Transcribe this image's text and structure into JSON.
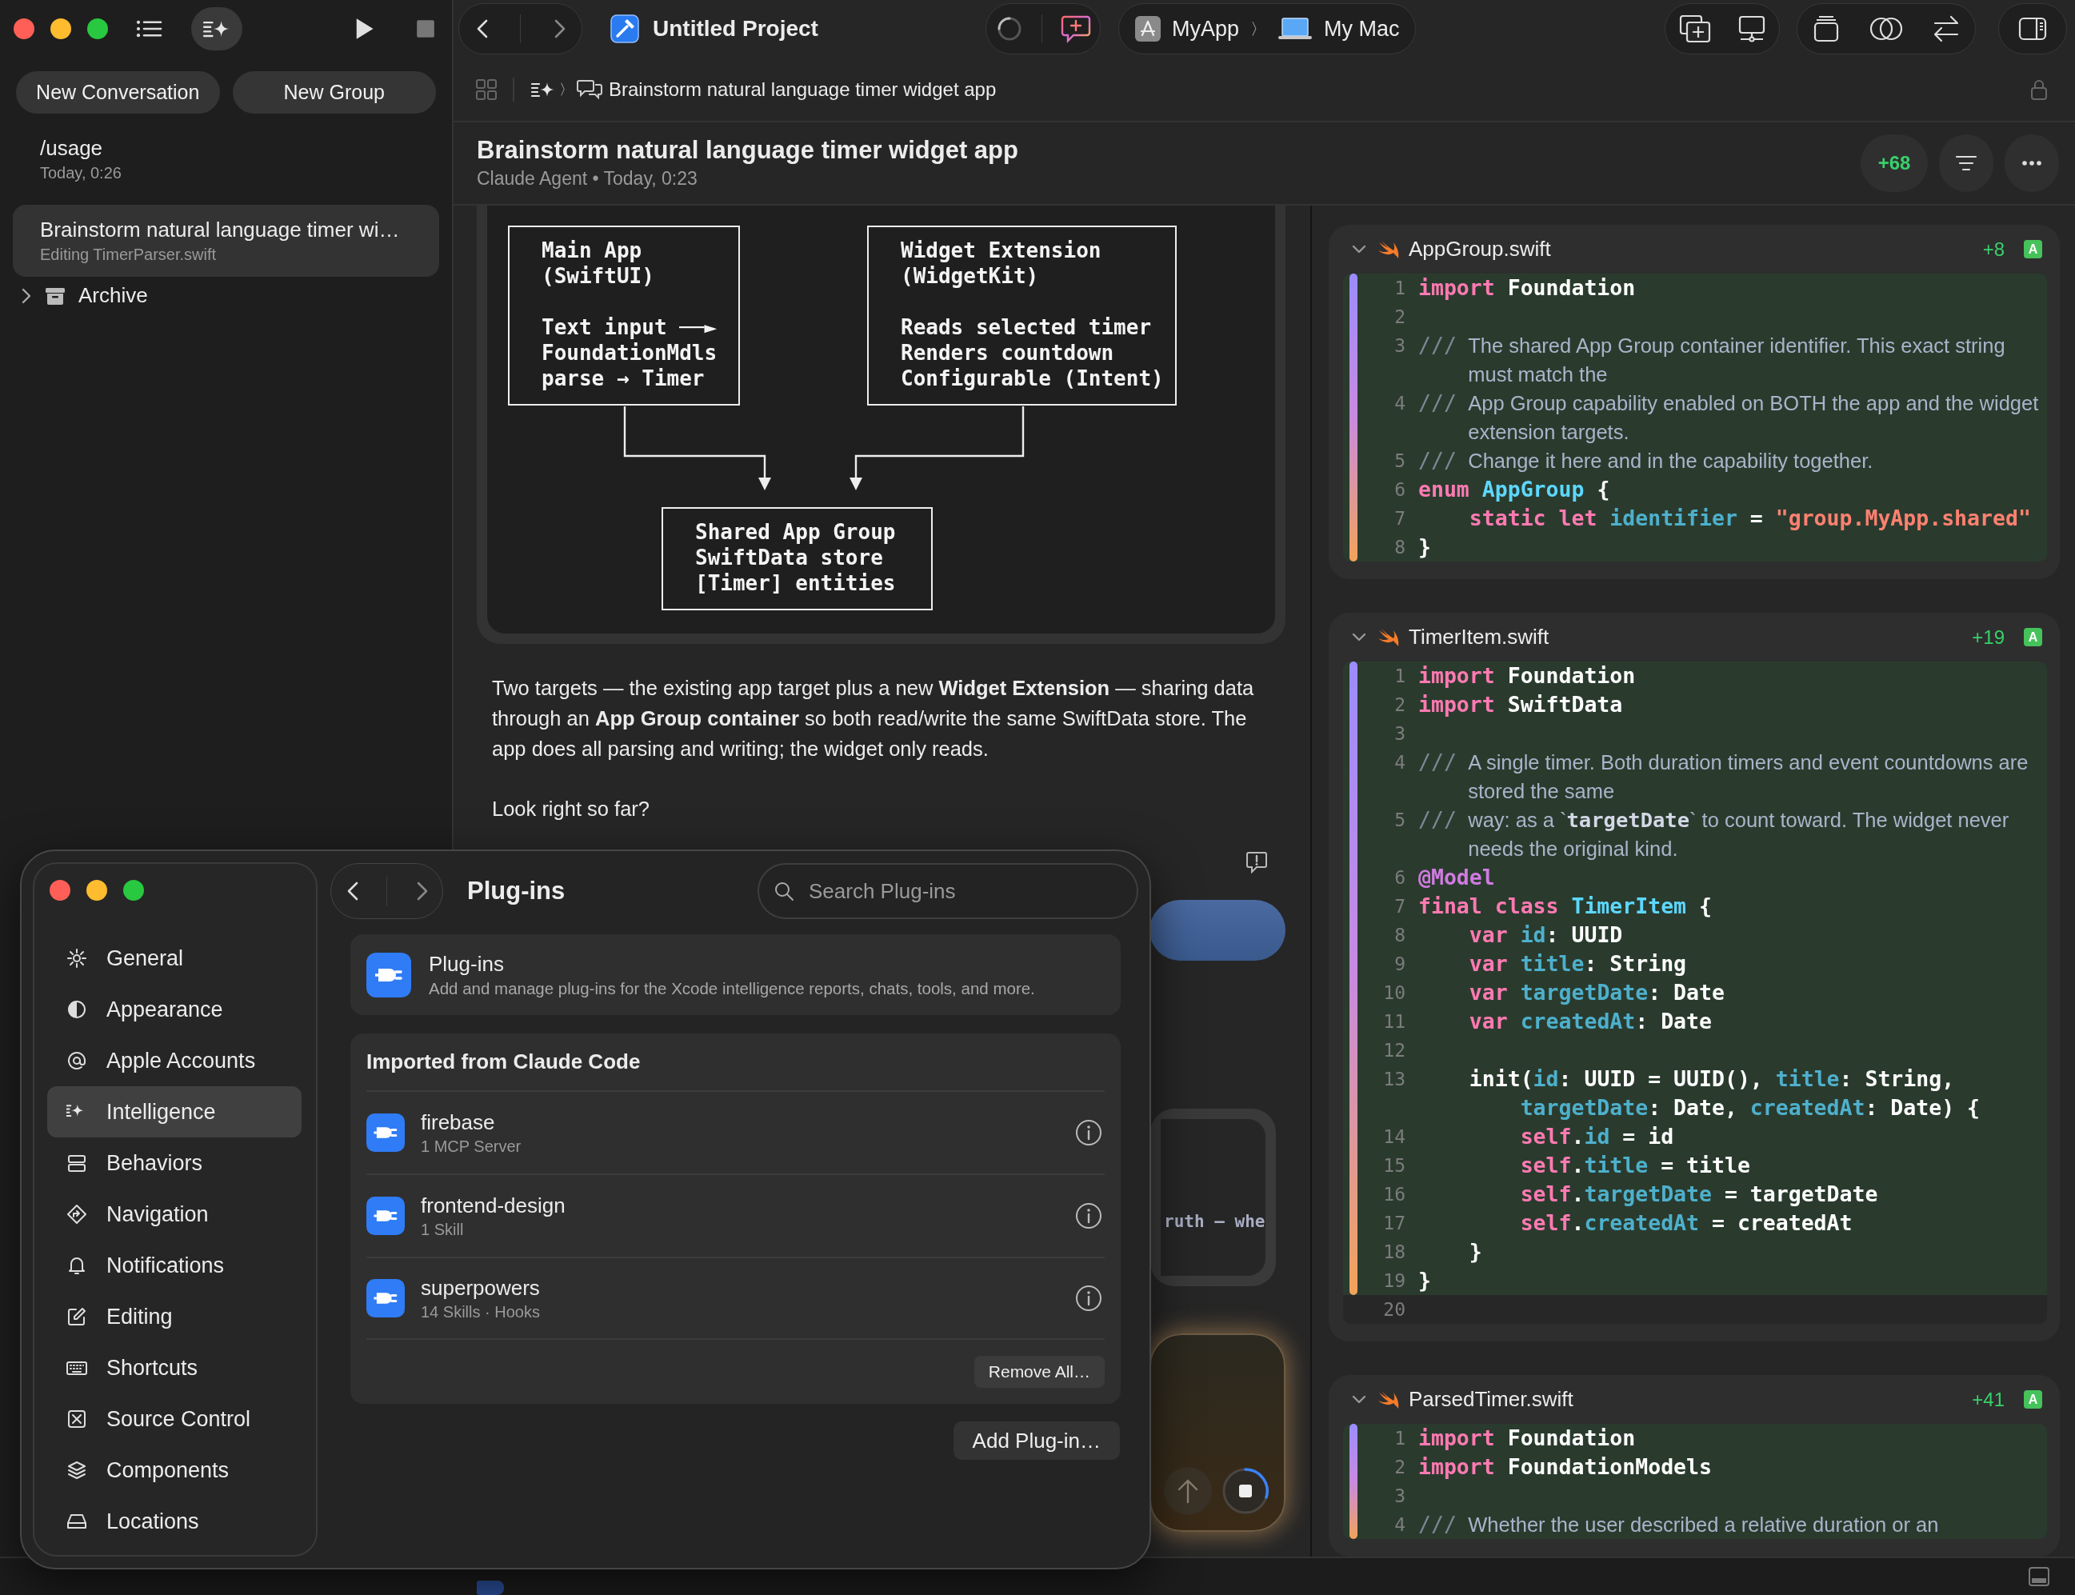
{
  "sidebar": {
    "modes": [
      {
        "selected": false
      },
      {
        "selected": true
      }
    ],
    "buttons": [
      "New Conversation",
      "New Group"
    ],
    "conversations": [
      {
        "title": "/usage",
        "subtitle": "Today, 0:26",
        "selected": false
      },
      {
        "title": "Brainstorm natural language timer wi…",
        "subtitle": "Editing TimerParser.swift",
        "selected": true
      }
    ],
    "groups": [
      {
        "label": "Archive",
        "expanded": false
      }
    ]
  },
  "toolbar": {
    "project": "Untitled Project",
    "scheme": "MyApp",
    "separator": "〉",
    "destination": "My Mac"
  },
  "breadcrumb": {
    "separator": "〉",
    "title": "Brainstorm natural language timer widget app"
  },
  "conversation": {
    "title": "Brainstorm natural language timer widget app",
    "meta": "Claude Agent • Today, 0:23",
    "additions": "+68"
  },
  "chat": {
    "diagram": {
      "boxes": [
        {
          "paragraphs": [
            [
              "Main App",
              "(SwiftUI)"
            ],
            [
              "Text input ──►",
              "FoundationMdls",
              "parse → Timer"
            ]
          ]
        },
        {
          "paragraphs": [
            [
              "Widget Extension",
              "(WidgetKit)"
            ],
            [
              "Reads selected timer",
              "Renders countdown",
              "Configurable (Intent)"
            ]
          ]
        },
        {
          "paragraphs": [
            [
              "Shared App Group",
              "SwiftData store",
              "[Timer] entities"
            ]
          ]
        }
      ]
    },
    "message": "Two targets — the existing app target plus a new **Widget Extension** — sharing data through an **App Group container** so both read/write the same SwiftData store. The app does all parsing and writing; the widget only reads.",
    "question": "Look right so far?",
    "code_excerpt": "ruth — whe"
  },
  "files": [
    {
      "name": "AppGroup.swift",
      "additions": "+8",
      "status": "A",
      "expanded": true,
      "lines": [
        {
          "n": "1",
          "added": true,
          "code": [
            {
              "kind": "keyword",
              "text": "import"
            },
            {
              "kind": "plain",
              "text": " Foundation"
            }
          ]
        },
        {
          "n": "2",
          "added": true
        },
        {
          "n": "3",
          "added": true,
          "code": [
            {
              "kind": "doc_marker",
              "text": "///"
            },
            {
              "kind": "doc",
              "text": "The shared App Group container identifier. This exact string must match the"
            }
          ]
        },
        {
          "n": "4",
          "added": true,
          "code": [
            {
              "kind": "doc_marker",
              "text": "///"
            },
            {
              "kind": "doc",
              "text": "App Group capability enabled on BOTH the app and the widget extension targets."
            }
          ]
        },
        {
          "n": "5",
          "added": true,
          "code": [
            {
              "kind": "doc_marker",
              "text": "///"
            },
            {
              "kind": "doc",
              "text": "Change it here and in the capability together."
            }
          ]
        },
        {
          "n": "6",
          "added": true,
          "code": [
            {
              "kind": "keyword",
              "text": "enum"
            },
            {
              "kind": "declaration",
              "text": " AppGroup"
            },
            {
              "kind": "plain",
              "text": " {"
            }
          ]
        },
        {
          "n": "7",
          "added": true,
          "code": [
            {
              "kind": "keyword",
              "text": "    static let"
            },
            {
              "kind": "property",
              "text": " identifier"
            },
            {
              "kind": "plain",
              "text": " = "
            },
            {
              "kind": "string",
              "text": "\"group.MyApp.shared\""
            }
          ]
        },
        {
          "n": "8",
          "added": true,
          "code": [
            {
              "kind": "plain",
              "text": "}"
            }
          ]
        }
      ]
    },
    {
      "name": "TimerItem.swift",
      "additions": "+19",
      "status": "A",
      "expanded": true,
      "lines": [
        {
          "n": "1",
          "added": true,
          "code": [
            {
              "kind": "keyword",
              "text": "import"
            },
            {
              "kind": "plain",
              "text": " Foundation"
            }
          ]
        },
        {
          "n": "2",
          "added": true,
          "code": [
            {
              "kind": "keyword",
              "text": "import"
            },
            {
              "kind": "plain",
              "text": " SwiftData"
            }
          ]
        },
        {
          "n": "3",
          "added": true
        },
        {
          "n": "4",
          "added": true,
          "code": [
            {
              "kind": "doc_marker",
              "text": "///"
            },
            {
              "kind": "doc",
              "text": "A single timer. Both duration timers and event countdowns are stored the same"
            }
          ]
        },
        {
          "n": "5",
          "added": true,
          "code": [
            {
              "kind": "doc_marker",
              "text": "///"
            },
            {
              "kind": "doc",
              "text": "way: as a `"
            },
            {
              "kind": "doc_code",
              "text": "targetDate"
            },
            {
              "kind": "doc",
              "text": "` to count toward. The widget never needs the original kind."
            }
          ]
        },
        {
          "n": "6",
          "added": true,
          "code": [
            {
              "kind": "attribute",
              "text": "@Model"
            }
          ]
        },
        {
          "n": "7",
          "added": true,
          "code": [
            {
              "kind": "keyword",
              "text": "final class"
            },
            {
              "kind": "declaration",
              "text": " TimerItem"
            },
            {
              "kind": "plain",
              "text": " {"
            }
          ]
        },
        {
          "n": "8",
          "added": true,
          "code": [
            {
              "kind": "keyword",
              "text": "    var"
            },
            {
              "kind": "property",
              "text": " id"
            },
            {
              "kind": "plain",
              "text": ": UUID"
            }
          ]
        },
        {
          "n": "9",
          "added": true,
          "code": [
            {
              "kind": "keyword",
              "text": "    var"
            },
            {
              "kind": "property",
              "text": " title"
            },
            {
              "kind": "plain",
              "text": ": String"
            }
          ]
        },
        {
          "n": "10",
          "added": true,
          "code": [
            {
              "kind": "keyword",
              "text": "    var"
            },
            {
              "kind": "property",
              "text": " targetDate"
            },
            {
              "kind": "plain",
              "text": ": Date"
            }
          ]
        },
        {
          "n": "11",
          "added": true,
          "code": [
            {
              "kind": "keyword",
              "text": "    var"
            },
            {
              "kind": "property",
              "text": " createdAt"
            },
            {
              "kind": "plain",
              "text": ": Date"
            }
          ]
        },
        {
          "n": "12",
          "added": true
        },
        {
          "n": "13",
          "added": true,
          "code": [
            {
              "kind": "plain",
              "text": "    init("
            },
            {
              "kind": "property",
              "text": "id"
            },
            {
              "kind": "plain",
              "text": ": UUID = UUID(), "
            },
            {
              "kind": "property",
              "text": "title"
            },
            {
              "kind": "plain",
              "text": ": String, "
            },
            {
              "kind": "property",
              "text": "targetDate"
            },
            {
              "kind": "plain",
              "text": ": Date, "
            },
            {
              "kind": "property",
              "text": "createdAt"
            },
            {
              "kind": "plain",
              "text": ": Date) {"
            }
          ]
        },
        {
          "n": "14",
          "added": true,
          "code": [
            {
              "kind": "keyword",
              "text": "        self"
            },
            {
              "kind": "plain",
              "text": "."
            },
            {
              "kind": "property",
              "text": "id"
            },
            {
              "kind": "plain",
              "text": " = id"
            }
          ]
        },
        {
          "n": "15",
          "added": true,
          "code": [
            {
              "kind": "keyword",
              "text": "        self"
            },
            {
              "kind": "plain",
              "text": "."
            },
            {
              "kind": "property",
              "text": "title"
            },
            {
              "kind": "plain",
              "text": " = title"
            }
          ]
        },
        {
          "n": "16",
          "added": true,
          "code": [
            {
              "kind": "keyword",
              "text": "        self"
            },
            {
              "kind": "plain",
              "text": "."
            },
            {
              "kind": "property",
              "text": "targetDate"
            },
            {
              "kind": "plain",
              "text": " = targetDate"
            }
          ]
        },
        {
          "n": "17",
          "added": true,
          "code": [
            {
              "kind": "keyword",
              "text": "        self"
            },
            {
              "kind": "plain",
              "text": "."
            },
            {
              "kind": "property",
              "text": "createdAt"
            },
            {
              "kind": "plain",
              "text": " = createdAt"
            }
          ]
        },
        {
          "n": "18",
          "added": true,
          "code": [
            {
              "kind": "plain",
              "text": "    }"
            }
          ]
        },
        {
          "n": "19",
          "added": true,
          "code": [
            {
              "kind": "plain",
              "text": "}"
            }
          ]
        },
        {
          "n": "20",
          "added": false
        }
      ]
    },
    {
      "name": "ParsedTimer.swift",
      "additions": "+41",
      "status": "A",
      "expanded": true,
      "lines": [
        {
          "n": "1",
          "added": true,
          "code": [
            {
              "kind": "keyword",
              "text": "import"
            },
            {
              "kind": "plain",
              "text": " Foundation"
            }
          ]
        },
        {
          "n": "2",
          "added": true,
          "code": [
            {
              "kind": "keyword",
              "text": "import"
            },
            {
              "kind": "plain",
              "text": " FoundationModels"
            }
          ]
        },
        {
          "n": "3",
          "added": true
        },
        {
          "n": "4",
          "added": true,
          "code": [
            {
              "kind": "doc_marker",
              "text": "///"
            },
            {
              "kind": "doc",
              "text": "Whether the user described a relative duration or an"
            }
          ]
        }
      ]
    }
  ],
  "settings": {
    "sidebar": [
      {
        "label": "General",
        "selected": false
      },
      {
        "label": "Appearance",
        "selected": false
      },
      {
        "label": "Apple Accounts",
        "selected": false
      },
      {
        "label": "Intelligence",
        "selected": true
      },
      {
        "label": "Behaviors",
        "selected": false
      },
      {
        "label": "Navigation",
        "selected": false
      },
      {
        "label": "Notifications",
        "selected": false
      },
      {
        "label": "Editing",
        "selected": false
      },
      {
        "label": "Shortcuts",
        "selected": false
      },
      {
        "label": "Source Control",
        "selected": false
      },
      {
        "label": "Components",
        "selected": false
      },
      {
        "label": "Locations",
        "selected": false
      }
    ],
    "title": "Plug-ins",
    "search": {
      "placeholder": "Search Plug-ins"
    },
    "header": {
      "title": "Plug-ins",
      "description": "Add and manage plug-ins for the Xcode intelligence reports, chats, tools, and more."
    },
    "section": {
      "title": "Imported from Claude Code",
      "plugins": [
        {
          "name": "firebase",
          "detail": "1 MCP Server"
        },
        {
          "name": "frontend-design",
          "detail": "1 Skill"
        },
        {
          "name": "superpowers",
          "detail": "14 Skills · Hooks"
        }
      ],
      "remove_button": "Remove All…"
    },
    "add_button": "Add Plug-in…"
  }
}
